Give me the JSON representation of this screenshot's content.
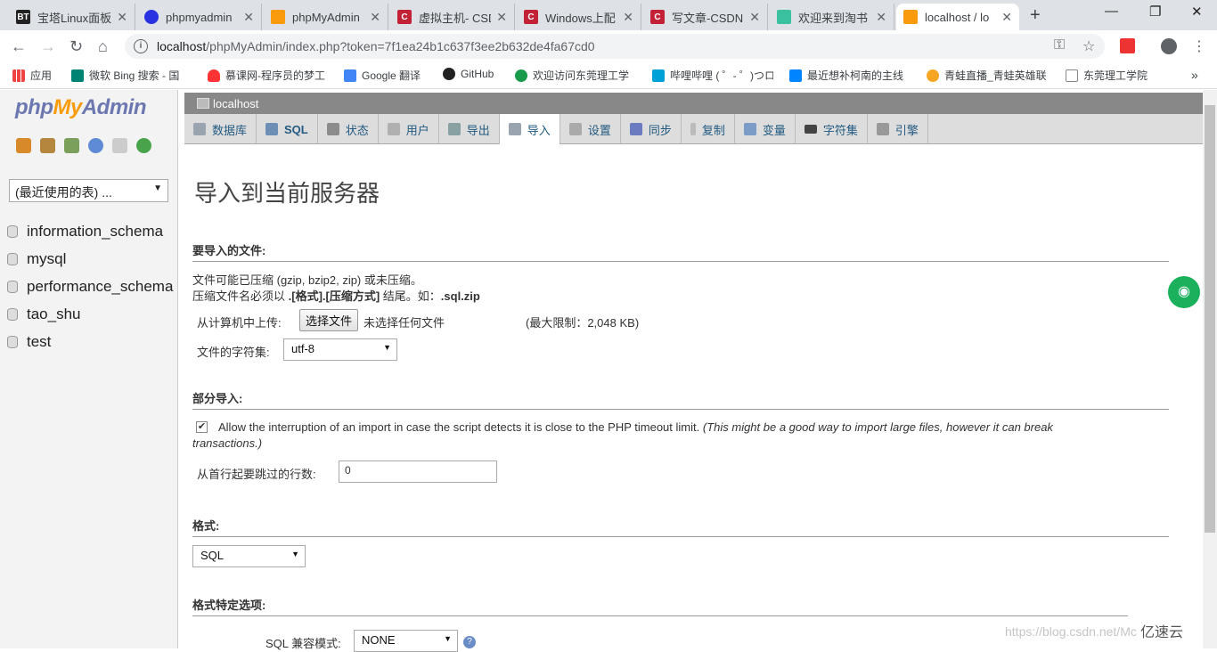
{
  "browser": {
    "tabs": [
      {
        "title": "宝塔Linux面板",
        "fav": "BT",
        "color": "#20a53a"
      },
      {
        "title": "phpmyadmin",
        "fav": "bd",
        "color": "#2932e1"
      },
      {
        "title": "phpMyAdmin",
        "fav": "P",
        "color": "#f89c0e"
      },
      {
        "title": "虚拟主机- CSD",
        "fav": "C",
        "color": "#c32136"
      },
      {
        "title": "Windows上配",
        "fav": "C",
        "color": "#c32136"
      },
      {
        "title": "写文章-CSDN",
        "fav": "C",
        "color": "#c32136"
      },
      {
        "title": "欢迎来到淘书",
        "fav": "T",
        "color": "#3bc0a0"
      },
      {
        "title": "localhost / lo",
        "fav": "P",
        "color": "#f89c0e"
      }
    ],
    "url_host": "localhost",
    "url_rest": "/phpMyAdmin/index.php?token=7f1ea24b1c637f3ee2b632de4fa67cd0",
    "bookmarks": [
      "应用",
      "微软 Bing 搜索 - 国",
      "慕课网-程序员的梦工",
      "Google 翻译",
      "GitHub",
      "欢迎访问东莞理工学",
      "哔哩哔哩 ( ゜- ゜)つロ",
      "最近想补柯南的主线",
      "青蛙直播_青蛙英雄联",
      "东莞理工学院"
    ]
  },
  "sidebar": {
    "recent_label": "(最近使用的表) ...",
    "databases": [
      "information_schema",
      "mysql",
      "performance_schema",
      "tao_shu",
      "test"
    ]
  },
  "server": {
    "name": "localhost"
  },
  "menu": [
    {
      "label": "数据库"
    },
    {
      "label": "SQL"
    },
    {
      "label": "状态"
    },
    {
      "label": "用户"
    },
    {
      "label": "导出"
    },
    {
      "label": "导入"
    },
    {
      "label": "设置"
    },
    {
      "label": "同步"
    },
    {
      "label": "复制"
    },
    {
      "label": "变量"
    },
    {
      "label": "字符集"
    },
    {
      "label": "引擎"
    }
  ],
  "page": {
    "title": "导入到当前服务器",
    "file_section": "要导入的文件:",
    "file_note1": "文件可能已压缩 (gzip, bzip2, zip) 或未压缩。",
    "file_note2a": "压缩文件名必须以 ",
    "file_note2b": ".[格式].[压缩方式]",
    "file_note2c": " 结尾。如：",
    "file_note2d": ".sql.zip",
    "upload_label": "从计算机中上传:",
    "choose_file": "选择文件",
    "no_file": "未选择任何文件",
    "max_limit": "(最大限制：2,048 KB)",
    "charset_label": "文件的字符集:",
    "charset_value": "utf-8",
    "partial_section": "部分导入:",
    "allow_interrupt": "Allow the interruption of an import in case the script detects it is close to the PHP timeout limit.",
    "allow_interrupt_note1": "(This might be a good way to import large files, however it can break",
    "allow_interrupt_note2": "transactions.)",
    "skip_label": "从首行起要跳过的行数:",
    "skip_value": "0",
    "format_section": "格式:",
    "format_value": "SQL",
    "format_opts_section": "格式特定选项:",
    "sql_compat_label": "SQL 兼容模式:",
    "sql_compat_value": "NONE"
  },
  "watermark": "https://blog.csdn.net/Mc",
  "corner_logo": "亿速云"
}
